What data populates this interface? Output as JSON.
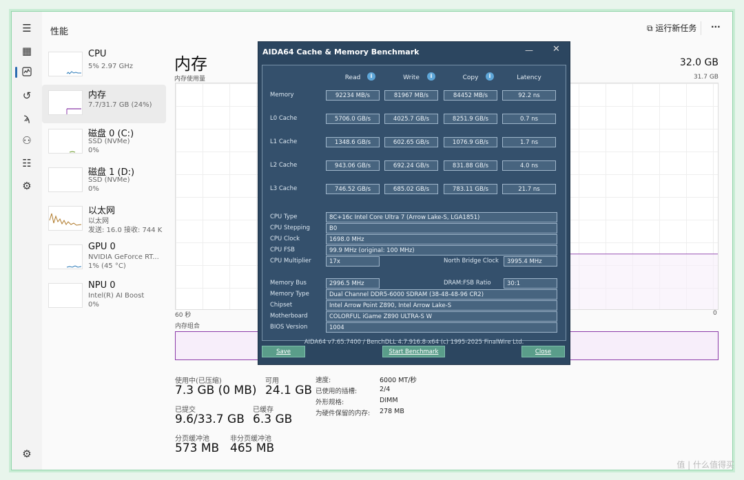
{
  "window": {
    "title": "性能",
    "run_task_label": "运行新任务",
    "more_label": "···"
  },
  "rail_icons": [
    "hamburger-icon",
    "processes-icon",
    "performance-icon",
    "history-icon",
    "startup-icon",
    "users-icon",
    "details-icon",
    "services-icon",
    "settings-icon"
  ],
  "sidebar": {
    "items": [
      {
        "label": "CPU",
        "sub1": "5%  2.97 GHz",
        "sub2": "",
        "sub3": ""
      },
      {
        "label": "内存",
        "sub1": "7.7/31.7 GB (24%)",
        "sub2": "",
        "sub3": ""
      },
      {
        "label": "磁盘 0 (C:)",
        "sub1": "SSD (NVMe)",
        "sub2": "0%",
        "sub3": ""
      },
      {
        "label": "磁盘 1 (D:)",
        "sub1": "SSD (NVMe)",
        "sub2": "0%",
        "sub3": ""
      },
      {
        "label": "以太网",
        "sub1": "以太网",
        "sub2": "发送: 16.0  接收: 744 K",
        "sub3": ""
      },
      {
        "label": "GPU 0",
        "sub1": "NVIDIA GeForce RT...",
        "sub2": "1% (45 °C)",
        "sub3": ""
      },
      {
        "label": "NPU 0",
        "sub1": "Intel(R) AI Boost",
        "sub2": "0%",
        "sub3": ""
      }
    ]
  },
  "main": {
    "title": "内存",
    "usage_label": "内存使用量",
    "total": "32.0 GB",
    "total_small": "31.7 GB",
    "time_left": "60 秒",
    "time_right": "0",
    "combo_label": "内存组合",
    "stats": {
      "in_use_label": "使用中(已压缩)",
      "in_use": "7.3 GB (0 MB)",
      "avail_label": "可用",
      "avail": "24.1 GB",
      "committed_label": "已提交",
      "committed": "9.6/33.7 GB",
      "cached_label": "已缓存",
      "cached": "6.3 GB",
      "paged_label": "分页缓冲池",
      "paged": "573 MB",
      "nonpaged_label": "非分页缓冲池",
      "nonpaged": "465 MB"
    },
    "kv": [
      {
        "k": "速度:",
        "v": "6000 MT/秒"
      },
      {
        "k": "已使用的插槽:",
        "v": "2/4"
      },
      {
        "k": "外形规格:",
        "v": "DIMM"
      },
      {
        "k": "为硬件保留的内存:",
        "v": "278 MB"
      }
    ]
  },
  "aida": {
    "title": "AIDA64 Cache & Memory Benchmark",
    "min_label": "—",
    "close_label": "✕",
    "headers": [
      "Read",
      "Write",
      "Copy",
      "Latency"
    ],
    "rows": [
      {
        "label": "Memory",
        "values": [
          "92234 MB/s",
          "81967 MB/s",
          "84452 MB/s",
          "92.2 ns"
        ]
      },
      {
        "label": "L0 Cache",
        "values": [
          "5706.0 GB/s",
          "4025.7 GB/s",
          "8251.9 GB/s",
          "0.7 ns"
        ]
      },
      {
        "label": "L1 Cache",
        "values": [
          "1348.6 GB/s",
          "602.65 GB/s",
          "1076.9 GB/s",
          "1.7 ns"
        ]
      },
      {
        "label": "L2 Cache",
        "values": [
          "943.06 GB/s",
          "692.24 GB/s",
          "831.88 GB/s",
          "4.0 ns"
        ]
      },
      {
        "label": "L3 Cache",
        "values": [
          "746.52 GB/s",
          "685.02 GB/s",
          "783.11 GB/s",
          "21.7 ns"
        ]
      }
    ],
    "cpu_type_label": "CPU Type",
    "cpu_type": "8C+16c Intel Core Ultra 7  (Arrow Lake-S, LGA1851)",
    "cpu_stepping_label": "CPU Stepping",
    "cpu_stepping": "B0",
    "cpu_clock_label": "CPU Clock",
    "cpu_clock": "1698.0 MHz",
    "cpu_fsb_label": "CPU FSB",
    "cpu_fsb": "99.9 MHz  (original: 100 MHz)",
    "cpu_mult_label": "CPU Multiplier",
    "cpu_mult": "17x",
    "nb_clock_label": "North Bridge Clock",
    "nb_clock": "3995.4 MHz",
    "mem_bus_label": "Memory Bus",
    "mem_bus": "2996.5 MHz",
    "dram_ratio_label": "DRAM:FSB Ratio",
    "dram_ratio": "30:1",
    "mem_type_label": "Memory Type",
    "mem_type": "Dual Channel DDR5-6000 SDRAM  (38-48-48-96 CR2)",
    "chipset_label": "Chipset",
    "chipset": "Intel Arrow Point Z890, Intel Arrow Lake-S",
    "mobo_label": "Motherboard",
    "mobo": "COLORFUL iGame Z890 ULTRA-S W",
    "bios_label": "BIOS Version",
    "bios": "1004",
    "footer": "AIDA64 v7.65.7400 / BenchDLL 4.7.916.8-x64  (c) 1995-2025 FinalWire Ltd.",
    "save_label": "Save",
    "start_label": "Start Benchmark",
    "close_btn_label": "Close"
  },
  "watermark": "值 | 什么值得买",
  "colors": {
    "memory_accent": "#8b3aa8",
    "aida_bg": "#2c4660",
    "button": "#5a9d8a"
  }
}
